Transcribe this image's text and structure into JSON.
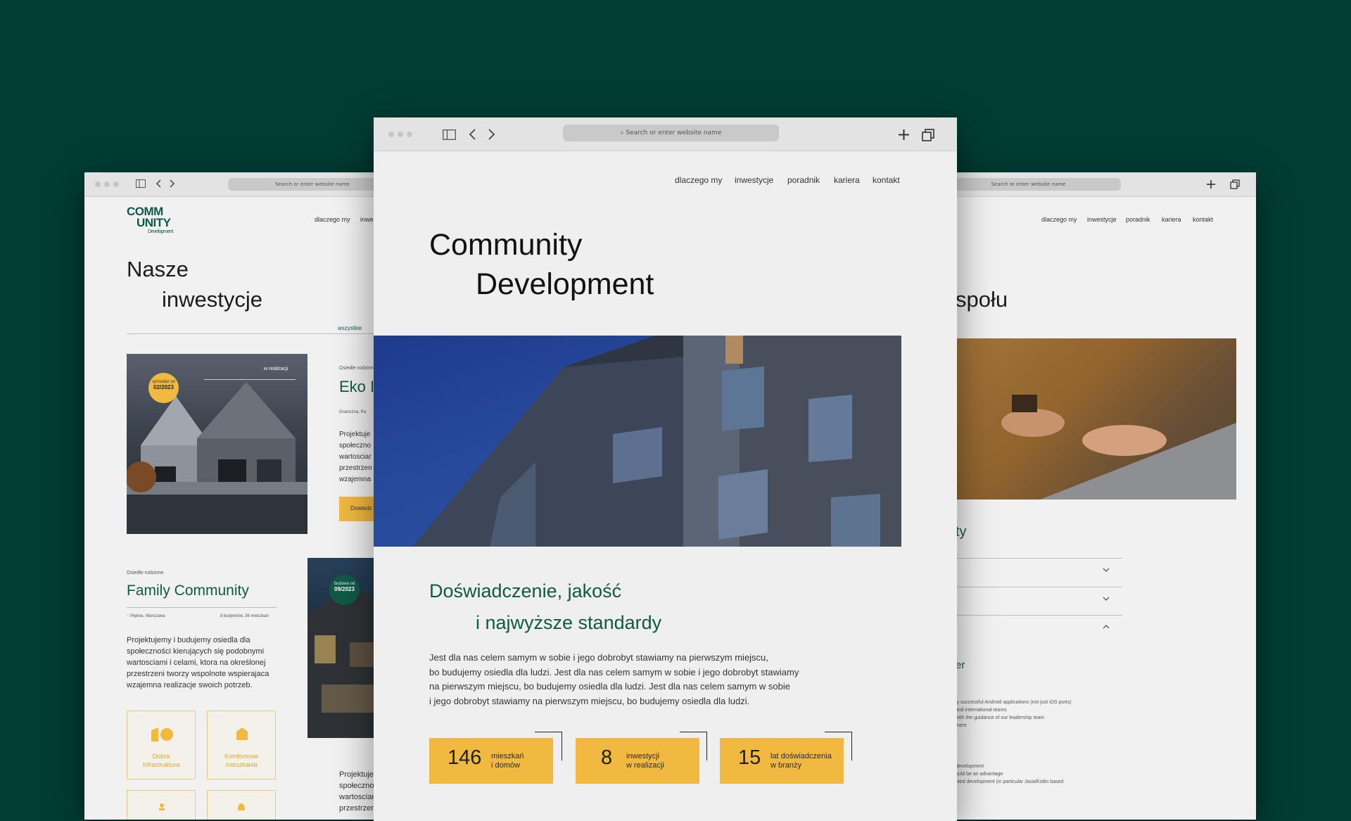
{
  "browser": {
    "url_placeholder": "Search or enter website name"
  },
  "left_page": {
    "logo": {
      "line1": "COMM",
      "line2": "UNITY",
      "sub": "Development"
    },
    "nav": [
      "dlaczego my",
      "inwe"
    ],
    "title_line1": "Nasze",
    "title_line2": "inwestycje",
    "filter_active": "wszystkie",
    "card1": {
      "badge_line1": "sprzedaż od",
      "badge_line2": "02/2023",
      "status": "w realizacji",
      "category": "Osiedle rodzinne",
      "title": "Eko I",
      "address": "Graniczna, Ra",
      "desc": [
        "Projektuje",
        "społeczno",
        "wartosciar",
        "przestrzen",
        "wzajemna"
      ],
      "cta": "Dowiedz"
    },
    "card2": {
      "category": "Osiedle rodzinne",
      "title": "Family Community",
      "address": "Piękna, Warszawa",
      "meta": "8 budynków, 36 mieszkań",
      "badge_line1": "budowa od",
      "badge_line2": "09/2023",
      "desc": [
        "Projektujemy i budujemy osiedla dla",
        "społeczności kierujących się podobnymi",
        "wartosciami i celami, ktora na określonej",
        "przestrzeni tworzy wspolnote wspierajaca",
        "wzajemna realizacje swoich potrzeb."
      ],
      "features": [
        {
          "icon": "infrastructure-icon",
          "label_line1": "Dobra",
          "label_line2": "infrastruktura"
        },
        {
          "icon": "home-icon",
          "label_line1": "Komfortowe",
          "label_line2": "mieszkania"
        }
      ],
      "desc2": [
        "Projektuje",
        "społeczno",
        "wartosciar",
        "przestrzen"
      ]
    }
  },
  "main_page": {
    "nav": [
      "dlaczego my",
      "inwestycje",
      "poradnik",
      "kariera",
      "kontakt"
    ],
    "hero_line1": "Community",
    "hero_line2": "Development",
    "heading_line1": "Doświadczenie, jakość",
    "heading_line2": "i najwyższe standardy",
    "body": [
      "Jest dla nas celem samym w sobie i jego dobrobyt stawiamy na pierwszym miejscu,",
      "bo budujemy osiedla dla ludzi. Jest dla nas celem samym w sobie i jego dobrobyt stawiamy",
      "na pierwszym miejscu, bo budujemy osiedla dla ludzi. Jest dla nas celem samym w sobie",
      "i jego dobrobyt stawiamy na pierwszym miejscu, bo budujemy osiedla dla ludzi."
    ],
    "stats": [
      {
        "value": "146",
        "label_line1": "mieszkań",
        "label_line2": "i domów"
      },
      {
        "value": "8",
        "label_line1": "inwestycji",
        "label_line2": "w realizacji"
      },
      {
        "value": "15",
        "label_line1": "lat doświadczenia",
        "label_line2": "w branży"
      }
    ]
  },
  "right_page": {
    "nav": [
      "dlaczego my",
      "inwestycje",
      "poradnik",
      "kariera",
      "kontakt"
    ],
    "title_fragment": "społu",
    "section_fragment": "ty",
    "sub_fragment": "er",
    "list1": [
      "ly successful Android applications (not just iOS ports)",
      "and international teams",
      "with the guidance of our leadership team",
      "ment"
    ],
    "list2": [
      "development",
      "ould be an advantage",
      "nted development (in particular Java/Kotlin based"
    ]
  },
  "colors": {
    "background": "#013d33",
    "accent_green": "#0f5a46",
    "accent_yellow": "#f2b940"
  }
}
